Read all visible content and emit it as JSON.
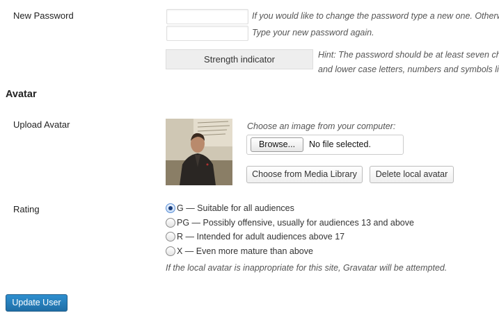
{
  "password": {
    "label": "New Password",
    "hint1": "If you would like to change the password type a new one. Otherwis",
    "hint2": "Type your new password again.",
    "strength_label": "Strength indicator",
    "strength_hint_line1": "Hint: The password should be at least seven char",
    "strength_hint_line2": "and lower case letters, numbers and symbols like"
  },
  "avatar_section": {
    "title": "Avatar",
    "upload_label": "Upload Avatar",
    "choose_text": "Choose an image from your computer:",
    "browse_label": "Browse...",
    "file_status": "No file selected.",
    "media_button": "Choose from Media Library",
    "delete_button": "Delete local avatar"
  },
  "rating": {
    "label": "Rating",
    "options": [
      {
        "label": "G — Suitable for all audiences",
        "checked": true
      },
      {
        "label": "PG — Possibly offensive, usually for audiences 13 and above",
        "checked": false
      },
      {
        "label": "R — Intended for adult audiences above 17",
        "checked": false
      },
      {
        "label": "X — Even more mature than above",
        "checked": false
      }
    ],
    "note": "If the local avatar is inappropriate for this site, Gravatar will be attempted."
  },
  "submit_label": "Update User",
  "colors": {
    "primary_button": "#2a7fbf",
    "radio_checked": "#1a3d7a"
  }
}
